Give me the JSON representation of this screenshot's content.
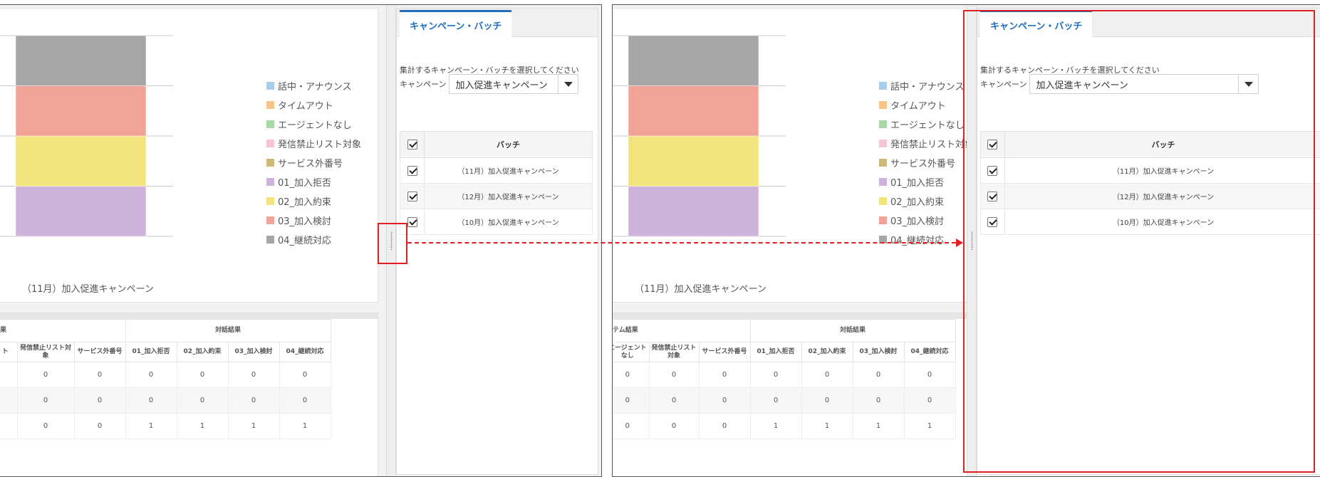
{
  "legend": [
    {
      "label": "話中・アナウンス",
      "color": "#a9cdea"
    },
    {
      "label": "タイムアウト",
      "color": "#f7c48a"
    },
    {
      "label": "エージェントなし",
      "color": "#a8d8a8"
    },
    {
      "label": "発信禁止リスト対象",
      "color": "#f6c4d6"
    },
    {
      "label": "サービス外番号",
      "color": "#cdb97a"
    },
    {
      "label": "01_加入拒否",
      "color": "#cdb3d9"
    },
    {
      "label": "02_加入約束",
      "color": "#f2e47c"
    },
    {
      "label": "03_加入検討",
      "color": "#f2a398"
    },
    {
      "label": "04_継続対応",
      "color": "#a6a6a6"
    }
  ],
  "chart_data": {
    "type": "bar",
    "stacked": true,
    "categories": [
      "（11月）加入促進キャンペーン"
    ],
    "series": [
      {
        "name": "01_加入拒否",
        "values": [
          1
        ],
        "color": "#cdb3d9"
      },
      {
        "name": "02_加入約束",
        "values": [
          1
        ],
        "color": "#f2e47c"
      },
      {
        "name": "03_加入検討",
        "values": [
          1
        ],
        "color": "#f2a398"
      },
      {
        "name": "04_継続対応",
        "values": [
          1
        ],
        "color": "#a6a6a6"
      }
    ],
    "ylim": [
      0,
      4
    ],
    "grid": true,
    "legend_position": "right"
  },
  "results_left": {
    "group_system": "結果",
    "group_talk": "対話結果",
    "columns": [
      "ト",
      "発信禁止リスト対象",
      "サービス外番号",
      "01_加入拒否",
      "02_加入約束",
      "03_加入検討",
      "04_継続対応"
    ],
    "rows": [
      [
        "",
        "0",
        "0",
        "0",
        "0",
        "0",
        "0"
      ],
      [
        "",
        "0",
        "0",
        "0",
        "0",
        "0",
        "0"
      ],
      [
        "",
        "0",
        "0",
        "1",
        "1",
        "1",
        "1"
      ]
    ]
  },
  "results_right": {
    "group_system": "ステム結果",
    "group_talk": "対話結果",
    "columns": [
      "エージェントなし",
      "発信禁止リスト対象",
      "サービス外番号",
      "01_加入拒否",
      "02_加入約束",
      "03_加入検討",
      "04_継続対応"
    ],
    "rows": [
      [
        "0",
        "0",
        "0",
        "0",
        "0",
        "0",
        "0"
      ],
      [
        "0",
        "0",
        "0",
        "0",
        "0",
        "0",
        "0"
      ],
      [
        "0",
        "0",
        "0",
        "1",
        "1",
        "1",
        "1"
      ]
    ]
  },
  "panel": {
    "tab_label": "キャンペーン・バッチ",
    "prompt": "集計するキャンペーン・バッチを選択してください",
    "field_label": "キャンペーン",
    "selected": "加入促進キャンペーン",
    "batch_header": "バッチ",
    "batches": [
      "（11月）加入促進キャンペーン",
      "（12月）加入促進キャンペーン",
      "（10月）加入促進キャンペーン"
    ]
  },
  "annotation_color": "#e02020"
}
